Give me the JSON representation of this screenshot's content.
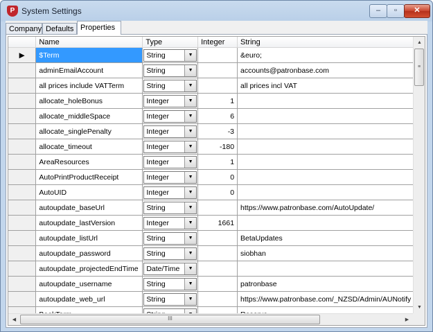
{
  "window": {
    "title": "System Settings",
    "icon": "patronbase-app-icon",
    "minimize": "minimize-icon",
    "maximize": "maximize-icon",
    "close": "close-icon",
    "minimize_glyph": "‒",
    "maximize_glyph": "▫",
    "close_glyph": "✕"
  },
  "tabs": [
    {
      "label": "Company"
    },
    {
      "label": "Defaults"
    },
    {
      "label": "Properties",
      "active": true
    }
  ],
  "grid": {
    "columns": [
      "Name",
      "Type",
      "Integer",
      "String"
    ],
    "row_indicator": "▶",
    "dropdown_arrow": "▼",
    "rows": [
      {
        "name": "$Term",
        "type": "String",
        "integer": "",
        "string": "&euro;"
      },
      {
        "name": "adminEmailAccount",
        "type": "String",
        "integer": "",
        "string": "accounts@patronbase.com"
      },
      {
        "name": "all prices include VATTerm",
        "type": "String",
        "integer": "",
        "string": "all prices incl VAT"
      },
      {
        "name": "allocate_holeBonus",
        "type": "Integer",
        "integer": "1",
        "string": ""
      },
      {
        "name": "allocate_middleSpace",
        "type": "Integer",
        "integer": "6",
        "string": ""
      },
      {
        "name": "allocate_singlePenalty",
        "type": "Integer",
        "integer": "-3",
        "string": ""
      },
      {
        "name": "allocate_timeout",
        "type": "Integer",
        "integer": "-180",
        "string": ""
      },
      {
        "name": "AreaResources",
        "type": "Integer",
        "integer": "1",
        "string": ""
      },
      {
        "name": "AutoPrintProductReceipt",
        "type": "Integer",
        "integer": "0",
        "string": ""
      },
      {
        "name": "AutoUID",
        "type": "Integer",
        "integer": "0",
        "string": ""
      },
      {
        "name": "autoupdate_baseUrl",
        "type": "String",
        "integer": "",
        "string": "https://www.patronbase.com/AutoUpdate/"
      },
      {
        "name": "autoupdate_lastVersion",
        "type": "Integer",
        "integer": "1661",
        "string": ""
      },
      {
        "name": "autoupdate_listUrl",
        "type": "String",
        "integer": "",
        "string": "BetaUpdates"
      },
      {
        "name": "autoupdate_password",
        "type": "String",
        "integer": "",
        "string": "siobhan"
      },
      {
        "name": "autoupdate_projectedEndTime",
        "type": "Date/Time",
        "integer": "",
        "string": ""
      },
      {
        "name": "autoupdate_username",
        "type": "String",
        "integer": "",
        "string": "patronbase"
      },
      {
        "name": "autoupdate_web_url",
        "type": "String",
        "integer": "",
        "string": "https://www.patronbase.com/_NZSD/Admin/AUNotify"
      },
      {
        "name": "BookTerm",
        "type": "String",
        "integer": "",
        "string": "Reserve"
      }
    ]
  },
  "scrollbars": {
    "up": "▲",
    "down": "▼",
    "left": "◀",
    "right": "▶",
    "thumb_grip_v": "≡",
    "thumb_grip_h": "III"
  }
}
